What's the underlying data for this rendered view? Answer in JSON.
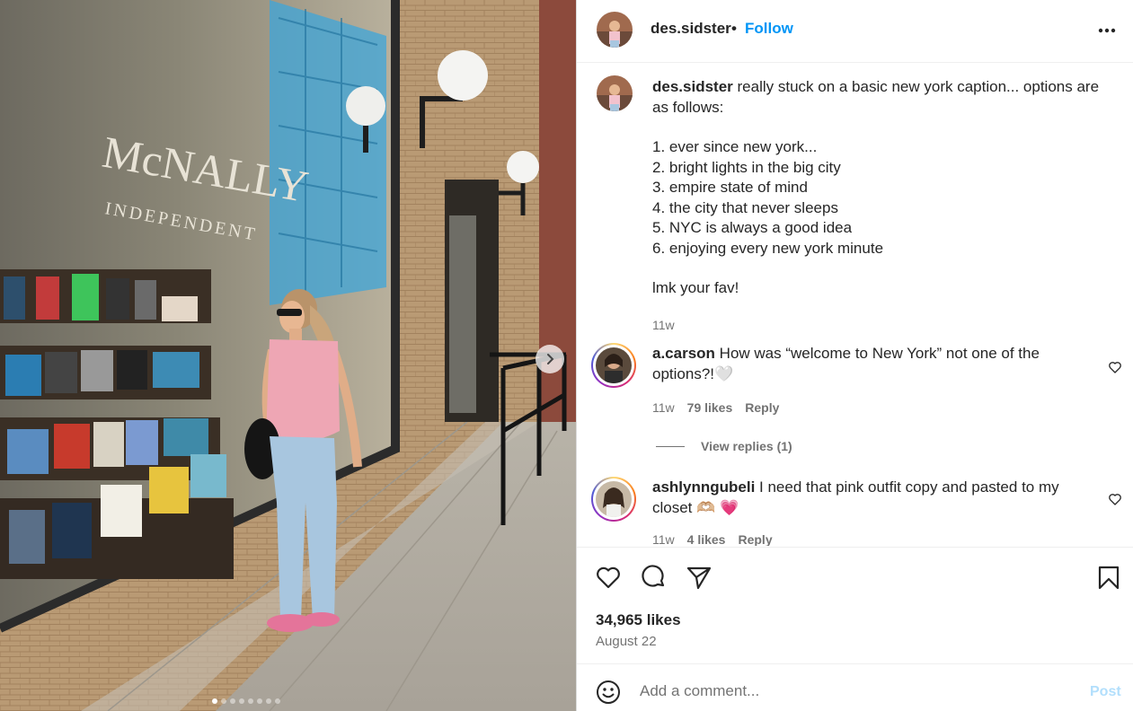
{
  "post": {
    "username": "des.sidster",
    "separator": "•",
    "follow_label": "Follow",
    "more_icon": "more-horizontal-icon"
  },
  "caption": {
    "username": "des.sidster",
    "text": "really stuck on a basic new york caption... options are as follows:",
    "options": [
      "1. ever since new york...",
      "2. bright lights in the big city",
      "3. empire state of mind",
      "4. the city that never sleeps",
      "5. NYC is always a good idea",
      "6. enjoying every new york minute"
    ],
    "closing": "lmk your fav!",
    "time": "11w"
  },
  "photo": {
    "storefront_name": "McNALLY",
    "storefront_sub": "INDEPENDENT",
    "slide_count": 8,
    "active_slide": 0
  },
  "comments": [
    {
      "username": "a.carson",
      "text": "How was “welcome to New York” not one of the options?!",
      "emoji": "🤍",
      "time": "11w",
      "likes": "79 likes",
      "reply_label": "Reply",
      "view_replies": "View replies (1)"
    },
    {
      "username": "ashlynngubeli",
      "text": "I need that pink outfit copy and pasted to my closet",
      "emoji": "🫶🏼 💗",
      "time": "11w",
      "likes": "4 likes",
      "reply_label": "Reply"
    }
  ],
  "actions": {
    "like_icon": "heart-icon",
    "comment_icon": "comment-icon",
    "share_icon": "share-icon",
    "save_icon": "bookmark-icon",
    "likes": "34,965 likes",
    "date": "August 22"
  },
  "comment_box": {
    "placeholder": "Add a comment...",
    "post_label": "Post"
  },
  "colors": {
    "accent": "#0095f6",
    "post_disabled": "#b2dffc",
    "secondary_text": "#737373"
  }
}
